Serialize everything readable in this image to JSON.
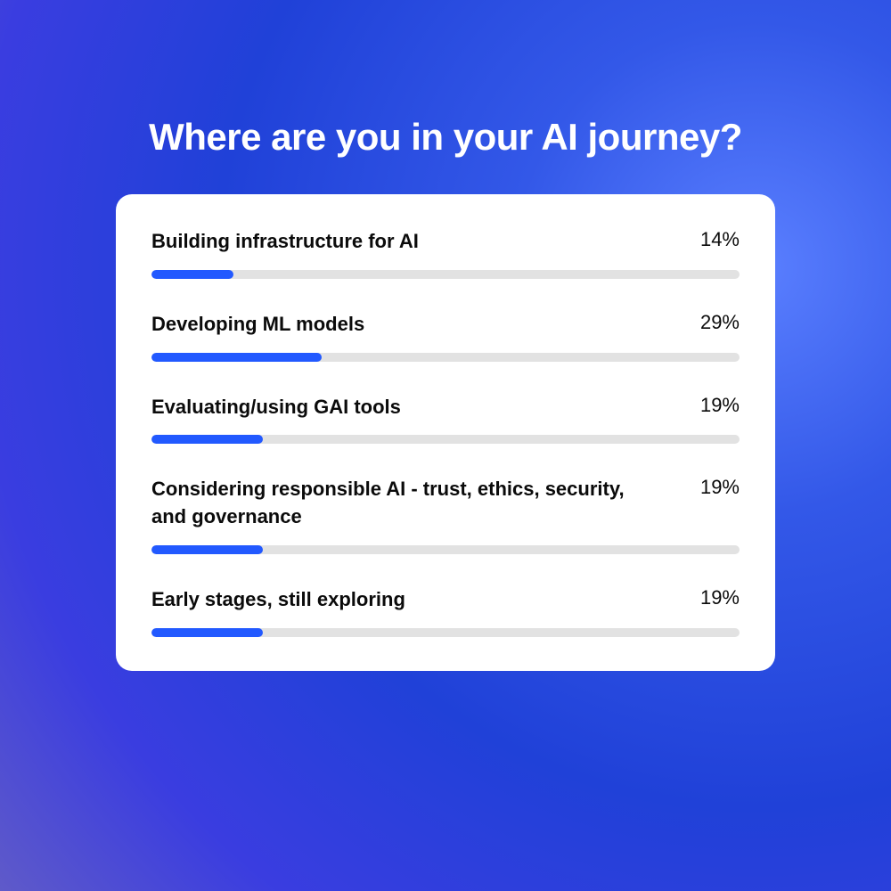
{
  "title": "Where are you in your AI journey?",
  "chart_data": {
    "type": "bar",
    "title": "Where are you in your AI journey?",
    "xlabel": "",
    "ylabel": "",
    "ylim": [
      0,
      100
    ],
    "categories": [
      "Building infrastructure for AI",
      "Developing ML models",
      "Evaluating/using GAI tools",
      "Considering responsible AI - trust, ethics, security, and governance",
      "Early stages, still exploring"
    ],
    "values": [
      14,
      29,
      19,
      19,
      19
    ],
    "value_labels": [
      "14%",
      "29%",
      "19%",
      "19%",
      "19%"
    ]
  },
  "colors": {
    "bar_fill": "#2259ff",
    "bar_track": "#e2e2e2",
    "card_bg": "#ffffff",
    "title_color": "#ffffff",
    "text_color": "#0b0b0b"
  }
}
